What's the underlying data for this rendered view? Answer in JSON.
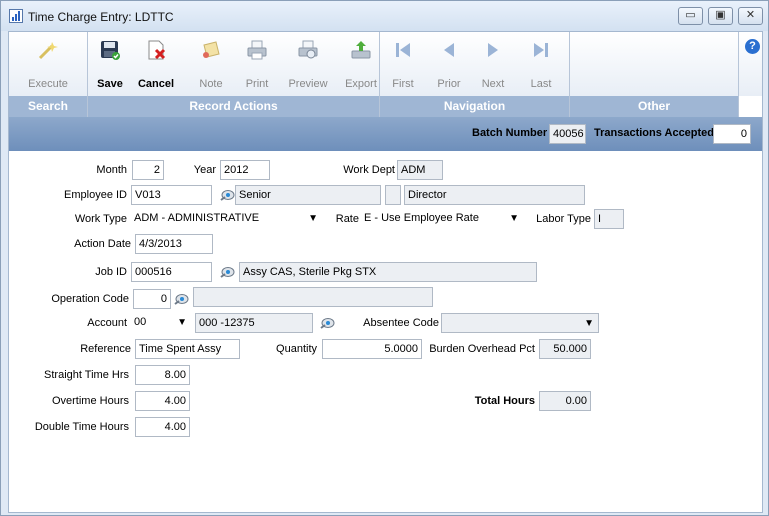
{
  "window": {
    "title": "Time Charge Entry: LDTTC"
  },
  "toolbar": {
    "buttons": [
      {
        "label": "Execute"
      },
      {
        "label": "Save"
      },
      {
        "label": "Cancel"
      },
      {
        "label": "Note"
      },
      {
        "label": "Print"
      },
      {
        "label": "Preview"
      },
      {
        "label": "Export"
      },
      {
        "label": "First"
      },
      {
        "label": "Prior"
      },
      {
        "label": "Next"
      },
      {
        "label": "Last"
      }
    ],
    "groups": [
      "Search",
      "Record Actions",
      "Navigation",
      "Other"
    ],
    "help_label": "?"
  },
  "batch": {
    "number_label": "Batch Number",
    "number": "40056",
    "accepted_label": "Transactions Accepted",
    "accepted": "0"
  },
  "form": {
    "month_label": "Month",
    "month": "2",
    "year_label": "Year",
    "year": "2012",
    "work_dept_label": "Work Dept",
    "work_dept": "ADM",
    "employee_id_label": "Employee ID",
    "employee_id": "V013",
    "employee_name": "Senior",
    "employee_title": "Director",
    "work_type_label": "Work Type",
    "work_type": "ADM - ADMINISTRATIVE",
    "rate_label": "Rate",
    "rate": "E - Use Employee Rate",
    "labor_type_label": "Labor Type",
    "labor_type": "I",
    "action_date_label": "Action Date",
    "action_date": "4/3/2013",
    "job_id_label": "Job ID",
    "job_id": "000516",
    "job_desc": "Assy CAS, Sterile Pkg STX",
    "operation_code_label": "Operation Code",
    "operation_code": "0",
    "operation_desc": "",
    "account_label": "Account",
    "account_prefix": "00",
    "account": "000 -12375",
    "absentee_code_label": "Absentee Code",
    "absentee_code": "",
    "reference_label": "Reference",
    "reference": "Time Spent Assy",
    "quantity_label": "Quantity",
    "quantity": "5.0000",
    "burden_label": "Burden Overhead Pct",
    "burden": "50.000",
    "straight_label": "Straight Time Hrs",
    "straight": "8.00",
    "overtime_label": "Overtime Hours",
    "overtime": "4.00",
    "total_label": "Total Hours",
    "total": "0.00",
    "double_label": "Double Time Hours",
    "double": "4.00"
  },
  "icons": {
    "dropdown": "▼",
    "window_buttons": [
      "minimize-icon",
      "restore-icon",
      "close-icon"
    ]
  }
}
